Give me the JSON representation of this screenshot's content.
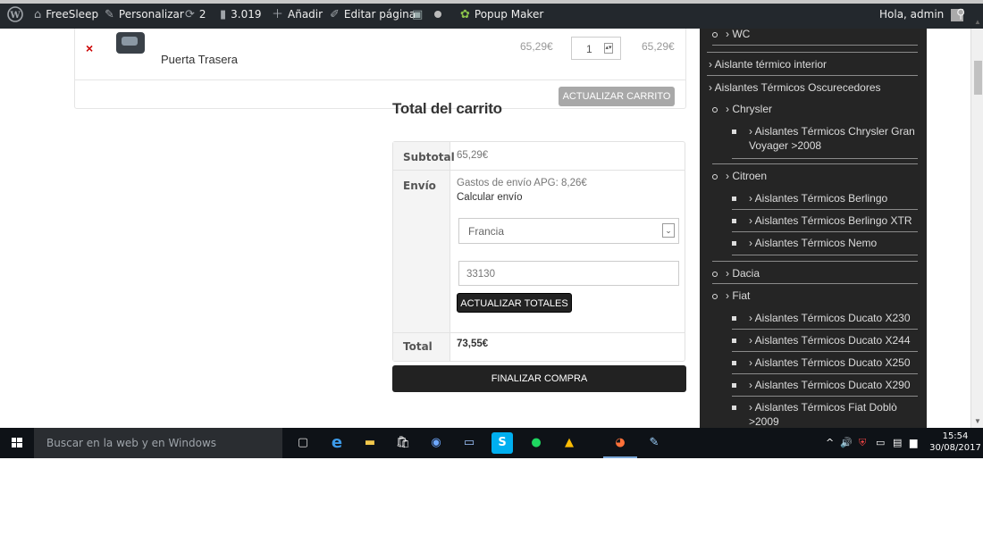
{
  "adminbar": {
    "wp_logo": "wordpress-logo",
    "site_name": "FreeSleep",
    "customize": "Personalizar",
    "updates_count": "2",
    "comments_count": "3.019",
    "add_new": "Añadir",
    "edit_page": "Editar página",
    "popup_maker": "Popup Maker",
    "greeting": "Hola, admin"
  },
  "cart": {
    "product_name": "Puerta Trasera",
    "price": "65,29€",
    "quantity": "1",
    "subtotal": "65,29€",
    "update_cart_label": "ACTUALIZAR CARRITO"
  },
  "totals": {
    "title": "Total del carrito",
    "subtotal_label": "Subtotal",
    "subtotal_value": "65,29€",
    "shipping_label": "Envío",
    "shipping_method": "Gastos de envío APG: 8,26€",
    "calc_shipping": "Calcular envío",
    "country": "Francia",
    "postcode": "33130",
    "update_totals_label": "ACTUALIZAR TOTALES",
    "total_label": "Total",
    "total_value": "73,55€",
    "checkout_label": "FINALIZAR COMPRA"
  },
  "sidebar": {
    "wc": "WC",
    "aislante_interior": "Aislante térmico interior",
    "oscurecedores": "Aislantes Térmicos Oscurecedores",
    "chrysler": "Chrysler",
    "chrysler_gv_line1": "Aislantes Térmicos Chrysler Gran",
    "chrysler_gv_line2": "Voyager >2008",
    "citroen": "Citroen",
    "berlingo": "Aislantes Térmicos Berlingo",
    "berlingo_xtr": "Aislantes Térmicos Berlingo XTR",
    "nemo": "Aislantes Térmicos Nemo",
    "dacia": "Dacia",
    "fiat": "Fiat",
    "ducato_x230": "Aislantes Térmicos Ducato X230",
    "ducato_x244": "Aislantes Térmicos Ducato X244",
    "ducato_x250": "Aislantes Térmicos Ducato X250",
    "ducato_x290": "Aislantes Térmicos Ducato X290",
    "doblo_line1": "Aislantes Térmicos Fiat Doblò",
    "doblo_line2": ">2009"
  },
  "taskbar": {
    "search_placeholder": "Buscar en la web y en Windows",
    "time": "15:54",
    "date": "30/08/2017"
  }
}
